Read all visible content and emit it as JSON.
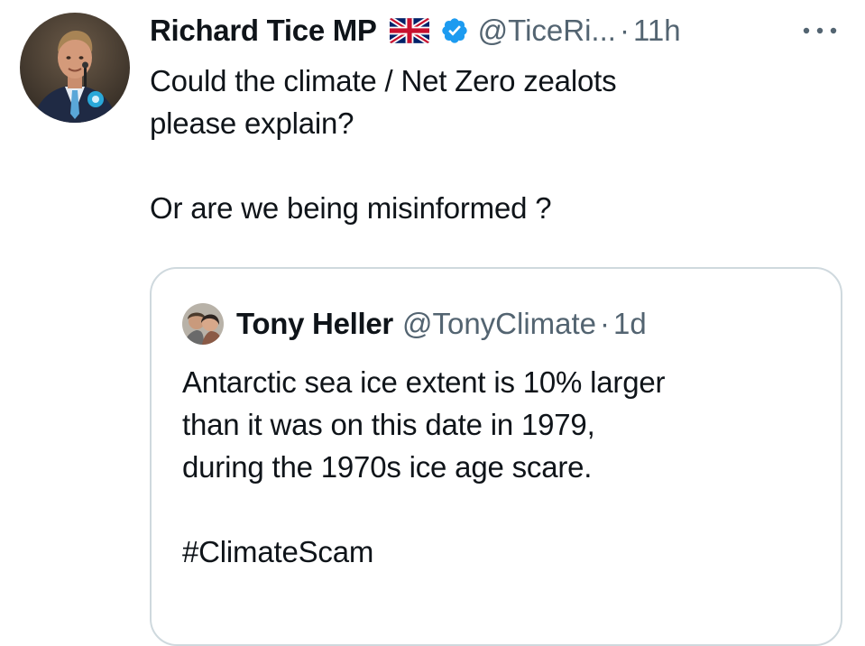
{
  "tweet": {
    "author_name": "Richard Tice MP",
    "handle": "@TiceRi...",
    "separator": "·",
    "time": "11h",
    "flag_icon": "uk-flag-icon",
    "verified_icon": "verified-badge-icon",
    "more_icon": "more-horizontal-icon",
    "verified_color": "#1d9bf0",
    "text_lines": [
      "Could the climate / Net Zero zealots",
      "please explain?",
      "",
      "Or are we being misinformed ?"
    ]
  },
  "quote": {
    "author_name": "Tony Heller",
    "handle": "@TonyClimate",
    "separator": "·",
    "time": "1d",
    "text_lines": [
      "Antarctic sea ice extent is 10% larger",
      "than it was on this date in 1979,",
      "during the 1970s ice age scare.",
      ""
    ],
    "hashtag": "#ClimateScam"
  },
  "colors": {
    "text": "#0f1419",
    "secondary": "#536471",
    "border": "#cfd9de",
    "accent": "#1d9bf0"
  }
}
